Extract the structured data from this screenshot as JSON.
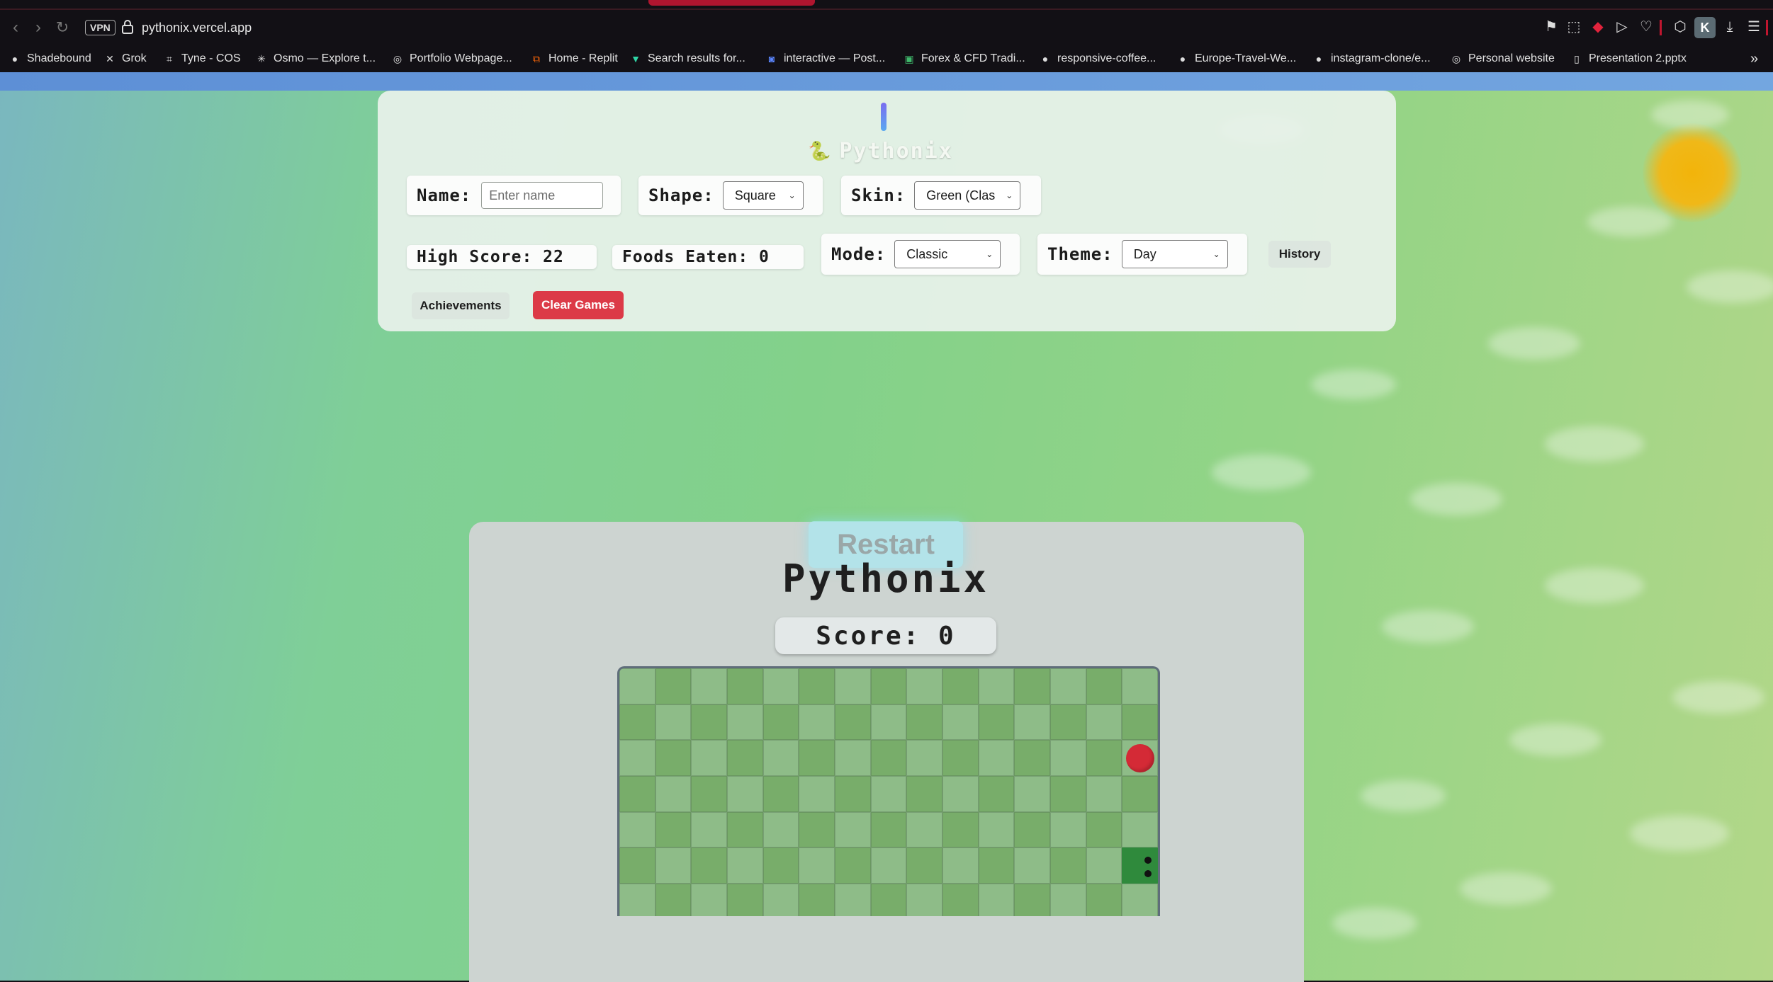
{
  "browser": {
    "url": "pythonix.vercel.app",
    "vpn_label": "VPN",
    "profile_initial": "K",
    "bookmarks": [
      {
        "label": "Shadebound",
        "icon": "dot-icon"
      },
      {
        "label": "Grok",
        "icon": "x-icon"
      },
      {
        "label": "Tyne - COS",
        "icon": "bracket-icon"
      },
      {
        "label": "Osmo — Explore t...",
        "icon": "sparkle-icon"
      },
      {
        "label": "Portfolio Webpage...",
        "icon": "globe-icon"
      },
      {
        "label": "Home - Replit",
        "icon": "replit-icon"
      },
      {
        "label": "Search results for...",
        "icon": "vercel-icon"
      },
      {
        "label": "interactive — Post...",
        "icon": "postman-icon"
      },
      {
        "label": "Forex & CFD Tradi...",
        "icon": "forex-icon"
      },
      {
        "label": "responsive-coffee...",
        "icon": "github-icon"
      },
      {
        "label": "Europe-Travel-We...",
        "icon": "github-icon"
      },
      {
        "label": "instagram-clone/e...",
        "icon": "github-icon"
      },
      {
        "label": "Personal website",
        "icon": "globe-icon"
      },
      {
        "label": "Presentation 2.pptx",
        "icon": "file-icon"
      }
    ]
  },
  "panel": {
    "brand": "Pythonix",
    "name_label": "Name:",
    "name_placeholder": "Enter name",
    "shape_label": "Shape:",
    "shape_value": "Square",
    "skin_label": "Skin:",
    "skin_value": "Green (Clas",
    "high_score": "High Score: 22",
    "foods_eaten": "Foods Eaten: 0",
    "mode_label": "Mode:",
    "mode_value": "Classic",
    "theme_label": "Theme:",
    "theme_value": "Day",
    "history_label": "History",
    "achievements_label": "Achievements",
    "clear_games_label": "Clear Games"
  },
  "game": {
    "restart_label": "Restart",
    "title": "Pythonix",
    "score": "Score: 0",
    "grid_cols": 15,
    "apple_cell": {
      "col": 14,
      "row": 2
    },
    "snake_head_cell": {
      "col": 14,
      "row": 5
    }
  },
  "colors": {
    "accent_danger": "#dc3a47",
    "apple": "#d42a36",
    "snake": "#2f8a3c"
  }
}
